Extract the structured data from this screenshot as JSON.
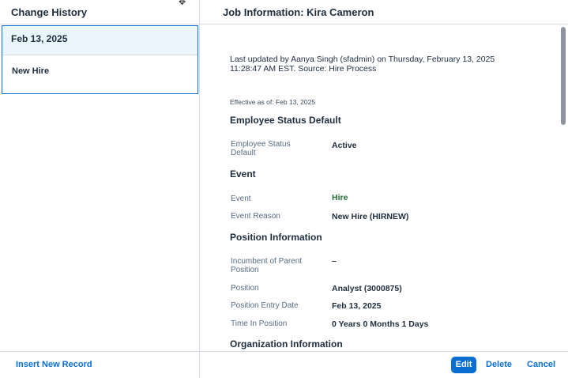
{
  "left": {
    "header": "Change History",
    "history": [
      {
        "date": "Feb 13, 2025",
        "event": "New Hire"
      }
    ]
  },
  "right": {
    "header": "Job Information: Kira Cameron",
    "meta_line1": "Last updated by Aanya Singh (sfadmin) on Thursday, February 13, 2025",
    "meta_line2": "11:28:47 AM EST. Source: Hire Process",
    "effective": "Effective as of: Feb 13, 2025",
    "sections": {
      "employee_status": {
        "title": "Employee Status Default",
        "label_line1": "Employee Status",
        "label_line2": "Default",
        "value": "Active"
      },
      "event": {
        "title": "Event",
        "event_label": "Event",
        "event_value": "Hire",
        "reason_label": "Event Reason",
        "reason_value": "New Hire (HIRNEW)"
      },
      "position": {
        "title": "Position Information",
        "incumbent_label_line1": "Incumbent of Parent",
        "incumbent_label_line2": "Position",
        "incumbent_value": "–",
        "position_label": "Position",
        "position_value": "Analyst (3000875)",
        "entry_label": "Position Entry Date",
        "entry_value": "Feb 13, 2025",
        "time_label": "Time In Position",
        "time_value": "0 Years 0 Months 1 Days"
      },
      "organization": {
        "title": "Organization Information"
      }
    }
  },
  "footer": {
    "insert_label": "Insert New Record",
    "edit_label": "Edit",
    "delete_label": "Delete",
    "cancel_label": "Cancel"
  },
  "colors": {
    "accent": "#0a6ed1",
    "selected_bg": "#eaf5fc",
    "positive": "#256f3a"
  }
}
